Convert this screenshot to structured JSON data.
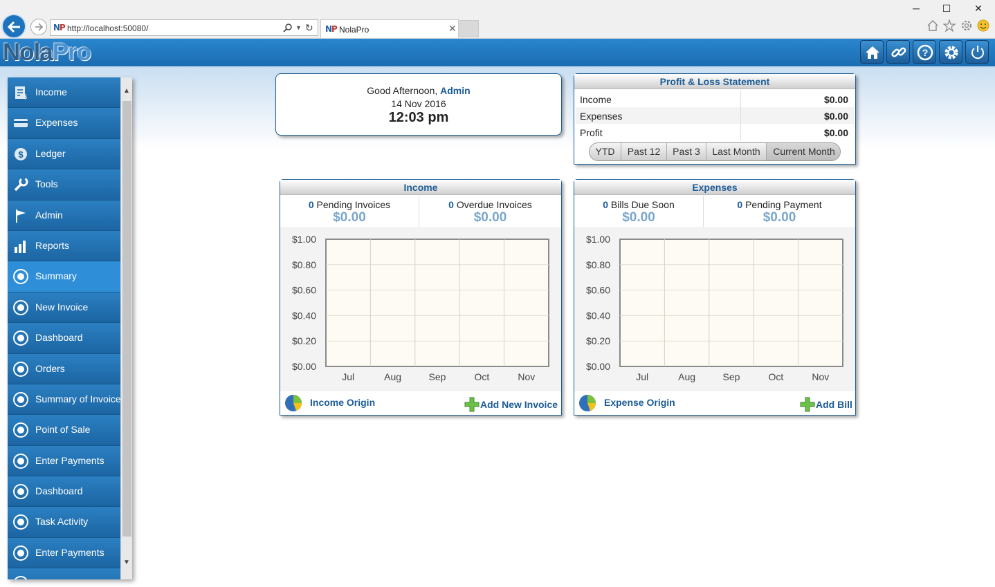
{
  "browser": {
    "url": "http://localhost:50080/",
    "tab_title": "NolaPro"
  },
  "app": {
    "logo_part1": "Nola",
    "logo_part2": "Pro",
    "header_buttons": [
      "home-icon",
      "link-icon",
      "help-icon",
      "settings-icon",
      "power-icon"
    ]
  },
  "sidebar": {
    "items": [
      {
        "label": "Income",
        "icon": "income-icon"
      },
      {
        "label": "Expenses",
        "icon": "expenses-icon"
      },
      {
        "label": "Ledger",
        "icon": "ledger-icon"
      },
      {
        "label": "Tools",
        "icon": "wrench-icon"
      },
      {
        "label": "Admin",
        "icon": "flag-icon"
      },
      {
        "label": "Reports",
        "icon": "bar-chart-icon"
      },
      {
        "label": "Summary",
        "icon": "radio-icon"
      },
      {
        "label": "New Invoice",
        "icon": "radio-icon"
      },
      {
        "label": "Dashboard",
        "icon": "radio-icon"
      },
      {
        "label": "Orders",
        "icon": "radio-icon"
      },
      {
        "label": "Summary of Invoice",
        "icon": "radio-icon"
      },
      {
        "label": "Point of Sale",
        "icon": "radio-icon"
      },
      {
        "label": "Enter Payments",
        "icon": "radio-icon"
      },
      {
        "label": "Dashboard",
        "icon": "radio-icon"
      },
      {
        "label": "Task Activity",
        "icon": "radio-icon"
      },
      {
        "label": "Enter Payments",
        "icon": "radio-icon"
      }
    ],
    "active_index": 6
  },
  "greeting": {
    "salutation": "Good Afternoon,",
    "user": "Admin",
    "date": "14 Nov 2016",
    "time": "12:03 pm"
  },
  "profit_loss": {
    "title": "Profit & Loss Statement",
    "rows": [
      {
        "label": "Income",
        "value": "$0.00"
      },
      {
        "label": "Expenses",
        "value": "$0.00"
      },
      {
        "label": "Profit",
        "value": "$0.00"
      }
    ],
    "periods": [
      "YTD",
      "Past 12",
      "Past 3",
      "Last Month",
      "Current Month"
    ],
    "selected_period": "Current Month"
  },
  "income_panel": {
    "title": "Income",
    "stat_left": {
      "count": "0",
      "label": "Pending Invoices",
      "amount": "$0.00"
    },
    "stat_right": {
      "count": "0",
      "label": "Overdue Invoices",
      "amount": "$0.00"
    },
    "origin_label": "Income Origin",
    "add_label": "Add New Invoice"
  },
  "expense_panel": {
    "title": "Expenses",
    "stat_left": {
      "count": "0",
      "label": "Bills Due Soon",
      "amount": "$0.00"
    },
    "stat_right": {
      "count": "0",
      "label": "Pending Payment",
      "amount": "$0.00"
    },
    "origin_label": "Expense Origin",
    "add_label": "Add Bill"
  },
  "chart_data": [
    {
      "type": "bar",
      "categories": [
        "Jul",
        "Aug",
        "Sep",
        "Oct",
        "Nov"
      ],
      "values": [
        0,
        0,
        0,
        0,
        0
      ],
      "ylim": [
        0,
        1
      ],
      "yticks": [
        "$0.00",
        "$0.20",
        "$0.40",
        "$0.60",
        "$0.80",
        "$1.00"
      ],
      "grid": true
    },
    {
      "type": "bar",
      "categories": [
        "Jul",
        "Aug",
        "Sep",
        "Oct",
        "Nov"
      ],
      "values": [
        0,
        0,
        0,
        0,
        0
      ],
      "ylim": [
        0,
        1
      ],
      "yticks": [
        "$0.00",
        "$0.20",
        "$0.40",
        "$0.60",
        "$0.80",
        "$1.00"
      ],
      "grid": true
    }
  ],
  "colors": {
    "brand_blue": "#1e73be",
    "panel_title": "#1c5c96",
    "amount": "#7aa6cc",
    "plot_bg": "#fdfbf4"
  }
}
